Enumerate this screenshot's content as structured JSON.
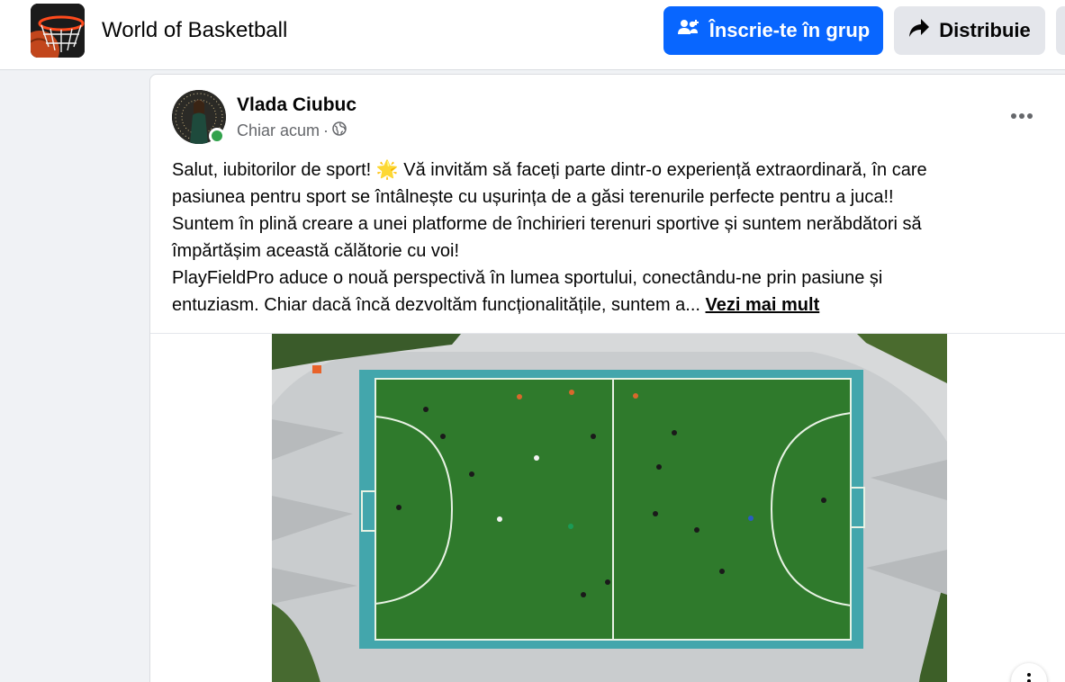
{
  "header": {
    "group_name": "World of Basketball",
    "join_label": "Înscrie-te în grup",
    "share_label": "Distribuie",
    "join_icon": "group-people-icon",
    "share_icon": "share-arrow-icon"
  },
  "post": {
    "author": "Vlada Ciubuc",
    "time": "Chiar acum",
    "separator": "·",
    "audience_icon": "globe-icon",
    "online": true,
    "lines": [
      "Salut, iubitorilor de sport! 🌟 Vă invităm să faceți parte dintr-o experiență extraordinară, în care",
      "pasiunea pentru sport se întâlnește cu ușurința de a găsi terenurile perfecte pentru a juca!!",
      "Suntem în plină creare a unei platforme de închirieri terenuri sportive și suntem nerăbdători să",
      "împărtășim această călătorie cu voi!",
      "PlayFieldPro aduce o nouă perspectivă în lumea sportului, conectându-ne prin pasiune și",
      "entuziasm. Chiar dacă încă dezvoltăm funcționalitățile, suntem a..."
    ],
    "see_more": "Vezi mai mult",
    "image": "aerial-football-pitch-photo"
  },
  "colors": {
    "primary": "#0866ff",
    "online": "#31a24c",
    "pitch": "#2f7a2c",
    "background": "#f0f2f5"
  }
}
